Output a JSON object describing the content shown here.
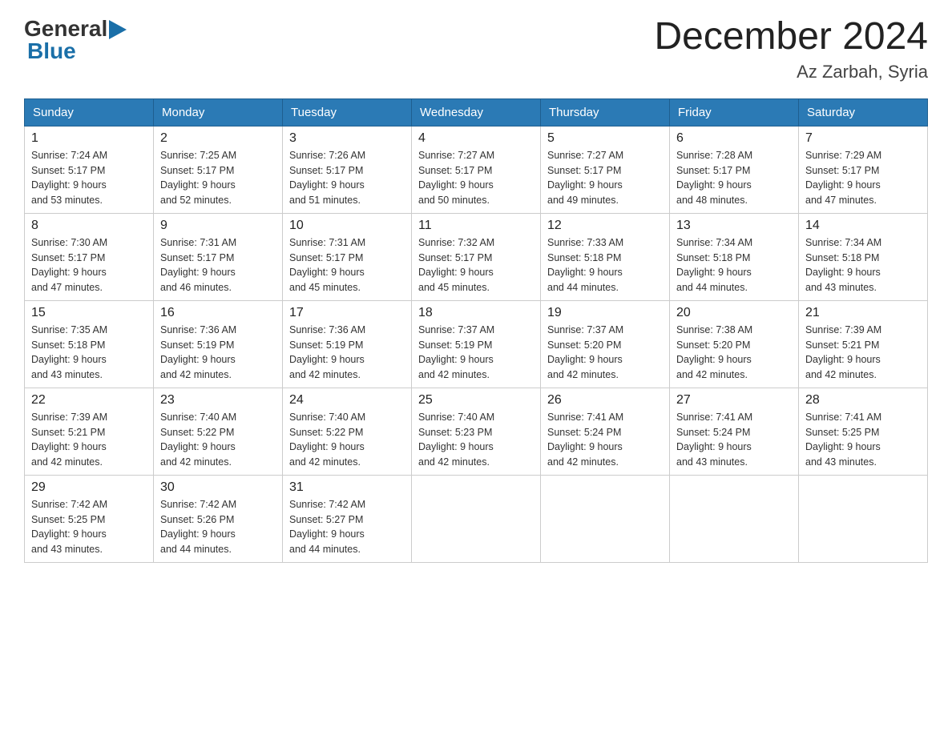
{
  "header": {
    "logo": {
      "general": "General",
      "blue": "Blue",
      "arrow": "▶"
    },
    "title": "December 2024",
    "location": "Az Zarbah, Syria"
  },
  "days_of_week": [
    "Sunday",
    "Monday",
    "Tuesday",
    "Wednesday",
    "Thursday",
    "Friday",
    "Saturday"
  ],
  "weeks": [
    [
      {
        "day": "1",
        "sunrise": "7:24 AM",
        "sunset": "5:17 PM",
        "daylight": "9 hours and 53 minutes."
      },
      {
        "day": "2",
        "sunrise": "7:25 AM",
        "sunset": "5:17 PM",
        "daylight": "9 hours and 52 minutes."
      },
      {
        "day": "3",
        "sunrise": "7:26 AM",
        "sunset": "5:17 PM",
        "daylight": "9 hours and 51 minutes."
      },
      {
        "day": "4",
        "sunrise": "7:27 AM",
        "sunset": "5:17 PM",
        "daylight": "9 hours and 50 minutes."
      },
      {
        "day": "5",
        "sunrise": "7:27 AM",
        "sunset": "5:17 PM",
        "daylight": "9 hours and 49 minutes."
      },
      {
        "day": "6",
        "sunrise": "7:28 AM",
        "sunset": "5:17 PM",
        "daylight": "9 hours and 48 minutes."
      },
      {
        "day": "7",
        "sunrise": "7:29 AM",
        "sunset": "5:17 PM",
        "daylight": "9 hours and 47 minutes."
      }
    ],
    [
      {
        "day": "8",
        "sunrise": "7:30 AM",
        "sunset": "5:17 PM",
        "daylight": "9 hours and 47 minutes."
      },
      {
        "day": "9",
        "sunrise": "7:31 AM",
        "sunset": "5:17 PM",
        "daylight": "9 hours and 46 minutes."
      },
      {
        "day": "10",
        "sunrise": "7:31 AM",
        "sunset": "5:17 PM",
        "daylight": "9 hours and 45 minutes."
      },
      {
        "day": "11",
        "sunrise": "7:32 AM",
        "sunset": "5:17 PM",
        "daylight": "9 hours and 45 minutes."
      },
      {
        "day": "12",
        "sunrise": "7:33 AM",
        "sunset": "5:18 PM",
        "daylight": "9 hours and 44 minutes."
      },
      {
        "day": "13",
        "sunrise": "7:34 AM",
        "sunset": "5:18 PM",
        "daylight": "9 hours and 44 minutes."
      },
      {
        "day": "14",
        "sunrise": "7:34 AM",
        "sunset": "5:18 PM",
        "daylight": "9 hours and 43 minutes."
      }
    ],
    [
      {
        "day": "15",
        "sunrise": "7:35 AM",
        "sunset": "5:18 PM",
        "daylight": "9 hours and 43 minutes."
      },
      {
        "day": "16",
        "sunrise": "7:36 AM",
        "sunset": "5:19 PM",
        "daylight": "9 hours and 42 minutes."
      },
      {
        "day": "17",
        "sunrise": "7:36 AM",
        "sunset": "5:19 PM",
        "daylight": "9 hours and 42 minutes."
      },
      {
        "day": "18",
        "sunrise": "7:37 AM",
        "sunset": "5:19 PM",
        "daylight": "9 hours and 42 minutes."
      },
      {
        "day": "19",
        "sunrise": "7:37 AM",
        "sunset": "5:20 PM",
        "daylight": "9 hours and 42 minutes."
      },
      {
        "day": "20",
        "sunrise": "7:38 AM",
        "sunset": "5:20 PM",
        "daylight": "9 hours and 42 minutes."
      },
      {
        "day": "21",
        "sunrise": "7:39 AM",
        "sunset": "5:21 PM",
        "daylight": "9 hours and 42 minutes."
      }
    ],
    [
      {
        "day": "22",
        "sunrise": "7:39 AM",
        "sunset": "5:21 PM",
        "daylight": "9 hours and 42 minutes."
      },
      {
        "day": "23",
        "sunrise": "7:40 AM",
        "sunset": "5:22 PM",
        "daylight": "9 hours and 42 minutes."
      },
      {
        "day": "24",
        "sunrise": "7:40 AM",
        "sunset": "5:22 PM",
        "daylight": "9 hours and 42 minutes."
      },
      {
        "day": "25",
        "sunrise": "7:40 AM",
        "sunset": "5:23 PM",
        "daylight": "9 hours and 42 minutes."
      },
      {
        "day": "26",
        "sunrise": "7:41 AM",
        "sunset": "5:24 PM",
        "daylight": "9 hours and 42 minutes."
      },
      {
        "day": "27",
        "sunrise": "7:41 AM",
        "sunset": "5:24 PM",
        "daylight": "9 hours and 43 minutes."
      },
      {
        "day": "28",
        "sunrise": "7:41 AM",
        "sunset": "5:25 PM",
        "daylight": "9 hours and 43 minutes."
      }
    ],
    [
      {
        "day": "29",
        "sunrise": "7:42 AM",
        "sunset": "5:25 PM",
        "daylight": "9 hours and 43 minutes."
      },
      {
        "day": "30",
        "sunrise": "7:42 AM",
        "sunset": "5:26 PM",
        "daylight": "9 hours and 44 minutes."
      },
      {
        "day": "31",
        "sunrise": "7:42 AM",
        "sunset": "5:27 PM",
        "daylight": "9 hours and 44 minutes."
      },
      null,
      null,
      null,
      null
    ]
  ],
  "labels": {
    "sunrise": "Sunrise:",
    "sunset": "Sunset:",
    "daylight": "Daylight:"
  }
}
